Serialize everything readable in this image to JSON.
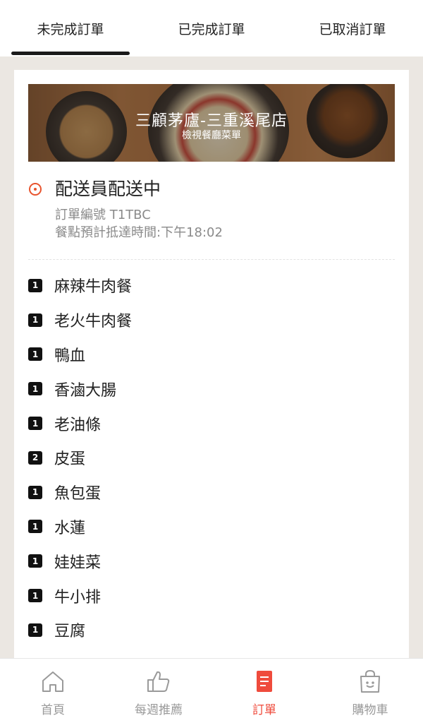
{
  "tabs": [
    {
      "label": "未完成訂單",
      "active": true
    },
    {
      "label": "已完成訂單",
      "active": false
    },
    {
      "label": "已取消訂單",
      "active": false
    }
  ],
  "order": {
    "restaurant_name": "三顧茅廬-三重溪尾店",
    "view_menu_label": "檢視餐廳菜單",
    "status": "配送員配送中",
    "order_number": "訂單編號 T1TBC",
    "eta": "餐點預計抵達時間:下午18:02",
    "items": [
      {
        "qty": "1",
        "name": "麻辣牛肉餐"
      },
      {
        "qty": "1",
        "name": "老火牛肉餐"
      },
      {
        "qty": "1",
        "name": "鴨血"
      },
      {
        "qty": "1",
        "name": "香滷大腸"
      },
      {
        "qty": "1",
        "name": "老油條"
      },
      {
        "qty": "2",
        "name": "皮蛋"
      },
      {
        "qty": "1",
        "name": "魚包蛋"
      },
      {
        "qty": "1",
        "name": "水蓮"
      },
      {
        "qty": "1",
        "name": "娃娃菜"
      },
      {
        "qty": "1",
        "name": "牛小排"
      },
      {
        "qty": "1",
        "name": "豆腐"
      }
    ]
  },
  "bottom_nav": [
    {
      "label": "首頁",
      "icon": "home-icon",
      "active": false
    },
    {
      "label": "每週推薦",
      "icon": "thumbs-up-icon",
      "active": false
    },
    {
      "label": "訂單",
      "icon": "order-list-icon",
      "active": true
    },
    {
      "label": "購物車",
      "icon": "shopping-bag-icon",
      "active": false
    }
  ],
  "colors": {
    "accent": "#ef4b3c",
    "status": "#e8542e",
    "background": "#ebe7e2"
  }
}
